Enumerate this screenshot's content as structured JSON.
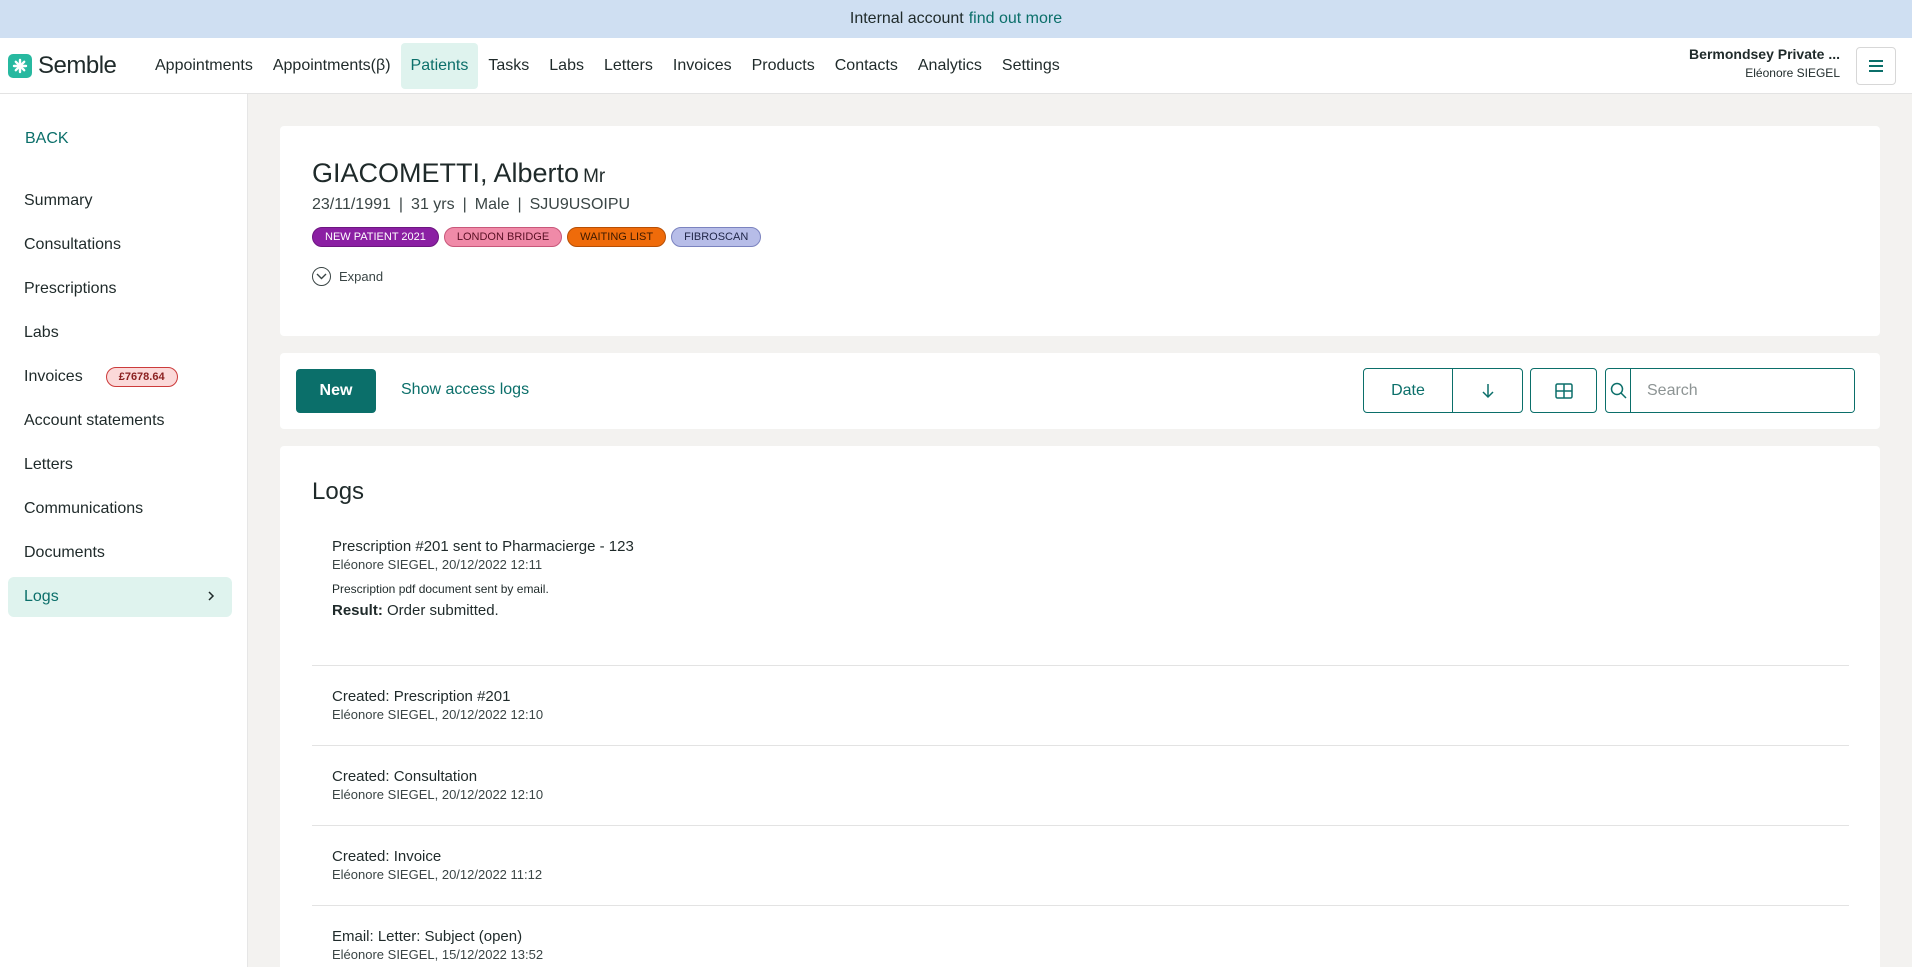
{
  "banner": {
    "text": "Internal account",
    "link": "find out more"
  },
  "brand": {
    "name": "Semble",
    "accent": "#0b6f6a",
    "logo_color": "#27b9a0"
  },
  "nav": {
    "items": [
      "Appointments",
      "Appointments(β)",
      "Patients",
      "Tasks",
      "Labs",
      "Letters",
      "Invoices",
      "Products",
      "Contacts",
      "Analytics",
      "Settings"
    ],
    "active": "Patients"
  },
  "account": {
    "org": "Bermondsey Private ...",
    "user": "Eléonore SIEGEL"
  },
  "sidebar": {
    "back": "BACK",
    "items": [
      {
        "label": "Summary"
      },
      {
        "label": "Consultations"
      },
      {
        "label": "Prescriptions"
      },
      {
        "label": "Labs"
      },
      {
        "label": "Invoices",
        "badge": "£7678.64"
      },
      {
        "label": "Account statements"
      },
      {
        "label": "Letters"
      },
      {
        "label": "Communications"
      },
      {
        "label": "Documents"
      },
      {
        "label": "Logs",
        "active": true
      }
    ]
  },
  "patient": {
    "name": "GIACOMETTI, Alberto",
    "title": "Mr",
    "dob": "23/11/1991",
    "age": "31 yrs",
    "sex": "Male",
    "id": "SJU9USOIPU",
    "tags": [
      {
        "label": "NEW PATIENT 2021",
        "bg": "#8b1fa3",
        "color": "#ffffff",
        "border": "#6d1580"
      },
      {
        "label": "LONDON BRIDGE",
        "bg": "#f08aa8",
        "color": "#5a1024",
        "border": "#c8577a"
      },
      {
        "label": "WAITING LIST",
        "bg": "#ef6b0a",
        "color": "#3d1a00",
        "border": "#b74f05"
      },
      {
        "label": "FIBROSCAN",
        "bg": "#b7bde8",
        "color": "#1f2546",
        "border": "#7b83bf"
      }
    ],
    "expand_label": "Expand"
  },
  "toolbar": {
    "new_label": "New",
    "access_logs_label": "Show access logs",
    "sort_label": "Date",
    "search_placeholder": "Search"
  },
  "logs": {
    "title": "Logs",
    "entries": [
      {
        "title": "Prescription #201 sent to Pharmacierge - 123",
        "meta": "Eléonore SIEGEL, 20/12/2022 12:11",
        "description": "Prescription pdf document sent by email.",
        "result_label": "Result:",
        "result_value": "Order  submitted."
      },
      {
        "title": "Created: Prescription #201",
        "meta": "Eléonore SIEGEL, 20/12/2022 12:10"
      },
      {
        "title": "Created: Consultation",
        "meta": "Eléonore SIEGEL, 20/12/2022 12:10"
      },
      {
        "title": "Created: Invoice",
        "meta": "Eléonore SIEGEL, 20/12/2022 11:12"
      },
      {
        "title": "Email: Letter: Subject (open)",
        "meta": "Eléonore SIEGEL, 15/12/2022 13:52"
      }
    ]
  }
}
